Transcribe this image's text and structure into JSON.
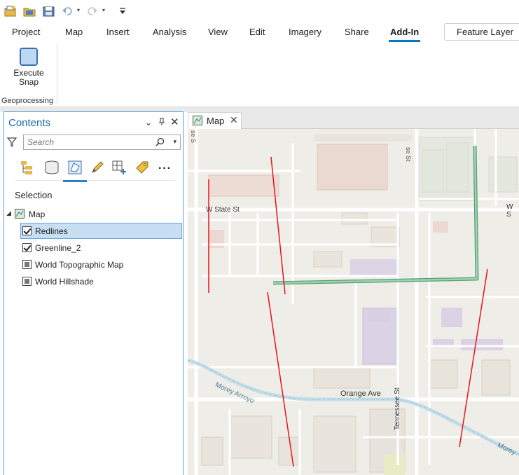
{
  "quick_access": {
    "icons": [
      "new-project-icon",
      "open-project-icon",
      "save-project-icon",
      "undo-icon",
      "redo-icon",
      "customize-icon"
    ]
  },
  "ribbon": {
    "tabs": [
      {
        "label": "Project",
        "active": false
      },
      {
        "label": "Map",
        "active": false
      },
      {
        "label": "Insert",
        "active": false
      },
      {
        "label": "Analysis",
        "active": false
      },
      {
        "label": "View",
        "active": false
      },
      {
        "label": "Edit",
        "active": false
      },
      {
        "label": "Imagery",
        "active": false
      },
      {
        "label": "Share",
        "active": false
      },
      {
        "label": "Add-In",
        "active": true
      }
    ],
    "contextual_tab": "Feature Layer",
    "execute_snap_label": "Execute\nSnap",
    "group_label": "Geoprocessing"
  },
  "contents": {
    "title": "Contents",
    "search_placeholder": "Search",
    "selection_heading": "Selection",
    "map_node": "Map",
    "layers": [
      {
        "label": "Redlines",
        "checked": true,
        "selected": true
      },
      {
        "label": "Greenline_2",
        "checked": true,
        "selected": false
      },
      {
        "label": "World Topographic Map",
        "checked": "partial",
        "selected": false
      },
      {
        "label": "World Hillshade",
        "checked": "partial",
        "selected": false
      }
    ]
  },
  "map_view": {
    "tab_label": "Map",
    "street_labels": {
      "w_state_st": "W State St",
      "w_s": "W S",
      "orange_ave": "Orange Ave",
      "tennessee_st": "Tennessee St",
      "se_st": "se St",
      "s_se": "se S",
      "morey_arroyo": "Morey Arroyo",
      "morey_right": "Morey"
    },
    "colors": {
      "redline": "#e8141a",
      "greenline": "#79c39a",
      "basemap": "#efede7"
    }
  }
}
